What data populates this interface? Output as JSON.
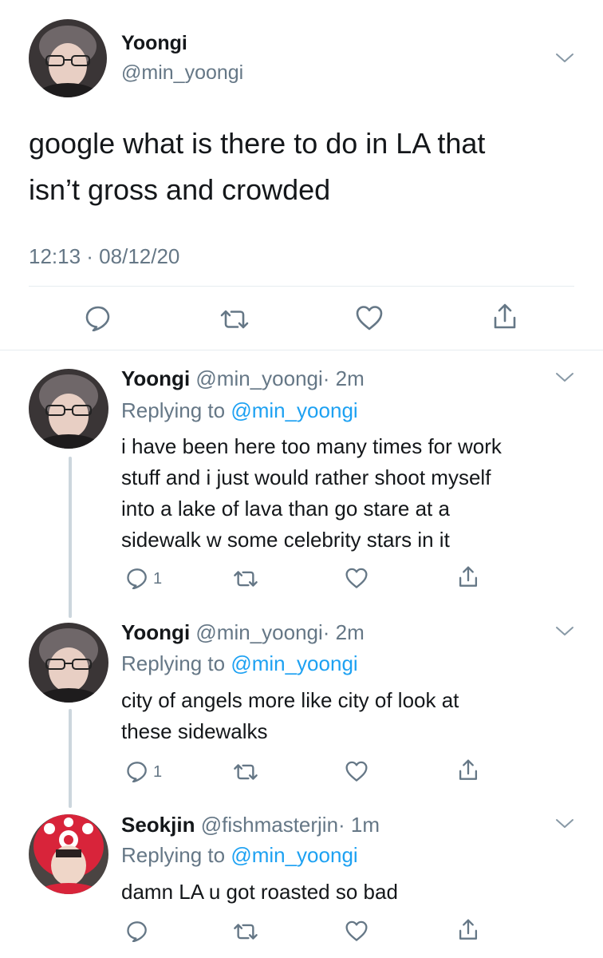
{
  "main_tweet": {
    "name": "Yoongi",
    "handle": "@min_yoongi",
    "text_line1": "google what is there to do in LA that",
    "text_line2": "isn’t gross and crowded",
    "timestamp": "12:13 · 08/12/20"
  },
  "replies": [
    {
      "name": "Yoongi",
      "handle": "@min_yoongi",
      "time": "· 2m",
      "replying_label": "Replying to",
      "replying_handle": "@min_yoongi",
      "lines": [
        "i have been here too many times for work",
        "stuff and i just would rather shoot myself",
        "into a lake of lava than go stare at a",
        "sidewalk w some celebrity stars in it"
      ],
      "reply_count": "1"
    },
    {
      "name": "Yoongi",
      "handle": "@min_yoongi",
      "time": "· 2m",
      "replying_label": "Replying to",
      "replying_handle": "@min_yoongi",
      "lines": [
        "city of angels more like city of look at",
        "these sidewalks"
      ],
      "reply_count": "1"
    },
    {
      "name": "Seokjin",
      "handle": "@fishmasterjin",
      "time": "· 1m",
      "replying_label": "Replying to",
      "replying_handle": "@min_yoongi",
      "lines": [
        "damn LA u got roasted so bad"
      ],
      "reply_count": ""
    }
  ],
  "icons": {
    "reply": "reply-bubble-icon",
    "retweet": "retweet-icon",
    "like": "heart-icon",
    "share": "share-icon",
    "more": "chevron-down-icon"
  },
  "colors": {
    "text": "#14171a",
    "secondary": "#657786",
    "link": "#1da1f2",
    "divider": "#e6ecf0",
    "thread": "#ccd6dd"
  }
}
